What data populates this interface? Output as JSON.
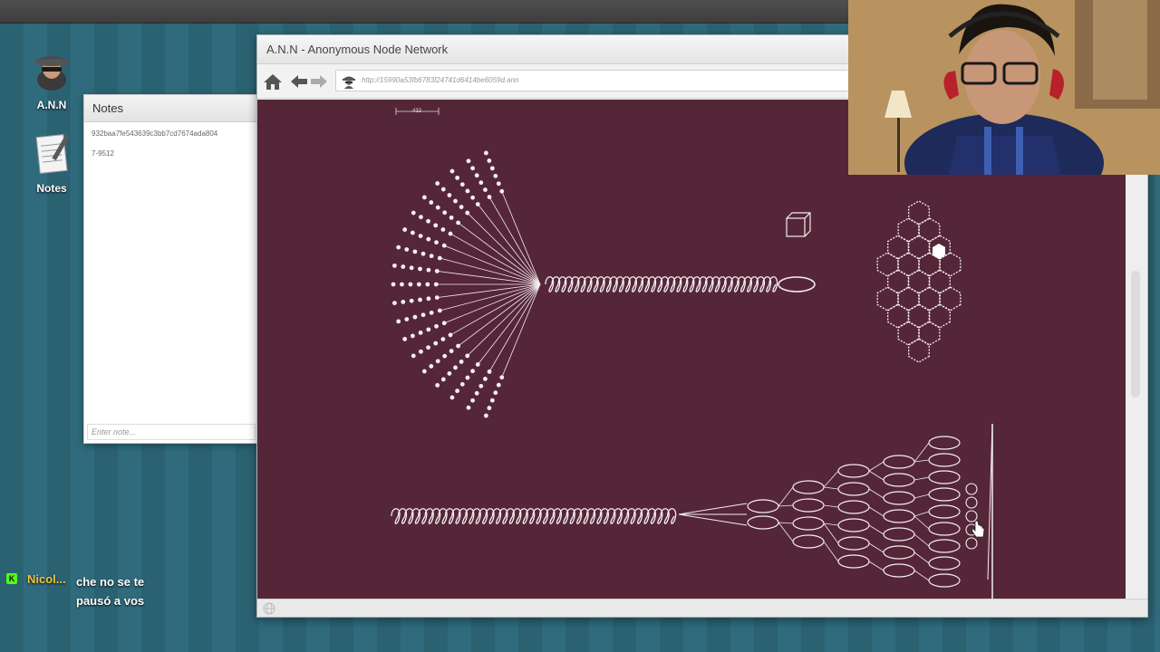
{
  "desktop": {
    "icons": [
      {
        "label": "A.N.N"
      },
      {
        "label": "Notes"
      }
    ]
  },
  "notes_window": {
    "title": "Notes",
    "lines": [
      "932baa7fe543639c3bb7cd7674ada804",
      "7-9512"
    ],
    "input_placeholder": "Enter note..."
  },
  "browser": {
    "title": "A.N.N - Anonymous Node Network",
    "url": "http://15990a53fb6783f24741d6414be6059d.ann",
    "scale_label": "432"
  },
  "chat": {
    "badge": "K",
    "user": "Nicol...",
    "message": "che no se te pausó a vos"
  },
  "colors": {
    "viewport_bg": "#552638",
    "desktop_stripe_a": "#2b6272",
    "desktop_stripe_b": "#2f6b7c",
    "chat_user": "#f2c23c",
    "chat_badge": "#53fc18"
  }
}
